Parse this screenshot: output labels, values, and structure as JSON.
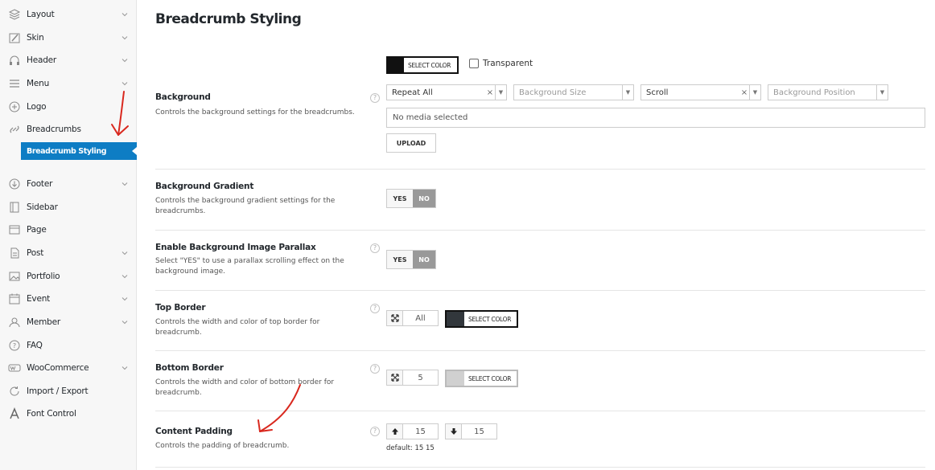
{
  "sidebar": {
    "items": [
      {
        "label": "Layout",
        "icon": "layers-icon",
        "chevron": true
      },
      {
        "label": "Skin",
        "icon": "brush-icon",
        "chevron": true
      },
      {
        "label": "Header",
        "icon": "headphones-icon",
        "chevron": true
      },
      {
        "label": "Menu",
        "icon": "menu-icon",
        "chevron": true
      },
      {
        "label": "Logo",
        "icon": "plus-circle-icon",
        "chevron": false
      },
      {
        "label": "Breadcrumbs",
        "icon": "link-icon",
        "chevron": false
      },
      {
        "label": "Footer",
        "icon": "arrow-down-circle-icon",
        "chevron": true
      },
      {
        "label": "Sidebar",
        "icon": "sidebar-icon",
        "chevron": false
      },
      {
        "label": "Page",
        "icon": "page-icon",
        "chevron": false
      },
      {
        "label": "Post",
        "icon": "post-icon",
        "chevron": true
      },
      {
        "label": "Portfolio",
        "icon": "image-icon",
        "chevron": true
      },
      {
        "label": "Event",
        "icon": "calendar-icon",
        "chevron": true
      },
      {
        "label": "Member",
        "icon": "users-icon",
        "chevron": true
      },
      {
        "label": "FAQ",
        "icon": "question-circle-icon",
        "chevron": false
      },
      {
        "label": "WooCommerce",
        "icon": "woocommerce-icon",
        "chevron": true
      },
      {
        "label": "Import / Export",
        "icon": "refresh-icon",
        "chevron": false
      },
      {
        "label": "Font Control",
        "icon": "font-icon",
        "chevron": false
      }
    ],
    "active_sub": "Breadcrumb Styling"
  },
  "main": {
    "title": "Breadcrumb Styling",
    "background": {
      "title": "Background",
      "desc": "Controls the background settings for the breadcrumbs.",
      "color_label": "SELECT COLOR",
      "transparent_label": "Transparent",
      "repeat_value": "Repeat All",
      "size_placeholder": "Background Size",
      "attachment_value": "Scroll",
      "position_placeholder": "Background Position",
      "media_text": "No media selected",
      "upload_label": "UPLOAD"
    },
    "gradient": {
      "title": "Background Gradient",
      "desc": "Controls the background gradient settings for the breadcrumbs.",
      "yes": "YES",
      "no": "NO"
    },
    "parallax": {
      "title": "Enable Background Image Parallax",
      "desc": "Select \"YES\" to use a parallax scrolling effect on the background image.",
      "yes": "YES",
      "no": "NO"
    },
    "top_border": {
      "title": "Top Border",
      "desc": "Controls the width and color of top border for breadcrumb.",
      "width_value": "All",
      "color_label": "SELECT COLOR"
    },
    "bottom_border": {
      "title": "Bottom Border",
      "desc": "Controls the width and color of bottom border for breadcrumb.",
      "width_value": "5",
      "color_label": "SELECT COLOR"
    },
    "padding": {
      "title": "Content Padding",
      "desc": "Controls the padding of breadcrumb.",
      "top_value": "15",
      "bottom_value": "15",
      "default_note": "default: 15 15"
    },
    "help_glyph": "?"
  },
  "colors": {
    "accent": "#0e7dc4",
    "bg_swatch_dark": "#111111",
    "top_border_swatch": "#32373c",
    "bottom_border_swatch": "#d0d0d0",
    "annotation": "#d9281e"
  }
}
